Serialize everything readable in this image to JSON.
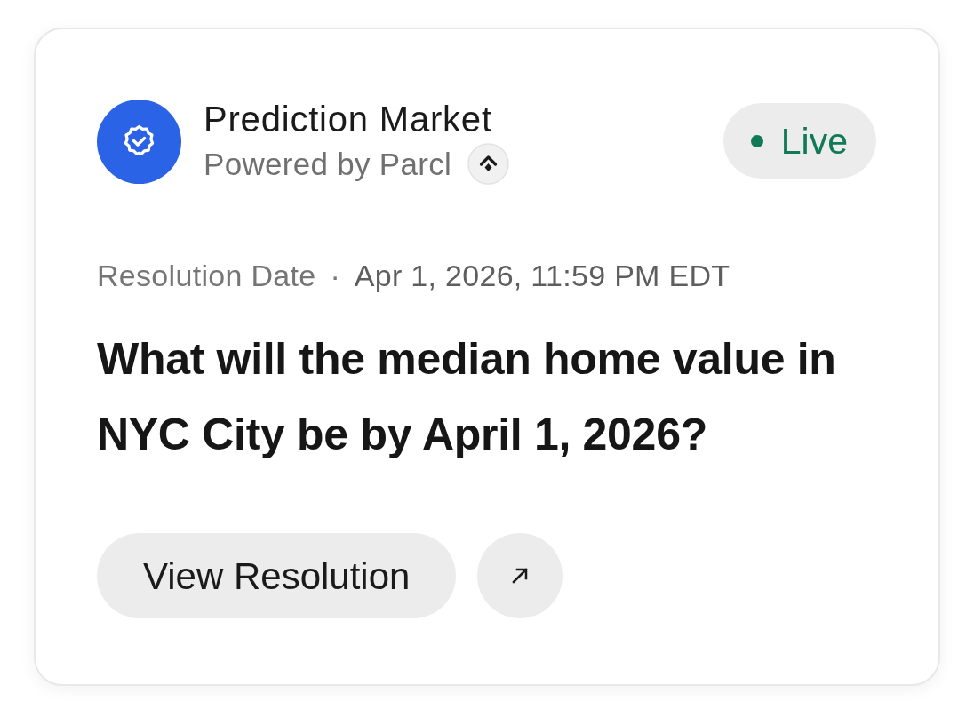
{
  "header": {
    "title": "Prediction Market",
    "subtitle": "Powered by Parcl"
  },
  "status_badge": {
    "label": "Live"
  },
  "resolution": {
    "label": "Resolution Date",
    "separator": "·",
    "value": "Apr 1, 2026, 11:59 PM EDT"
  },
  "question": "What will the median home value in NYC City be by April 1, 2026?",
  "buttons": [
    {
      "kind": "text",
      "label": "View Resolution"
    },
    {
      "kind": "icon"
    }
  ]
}
